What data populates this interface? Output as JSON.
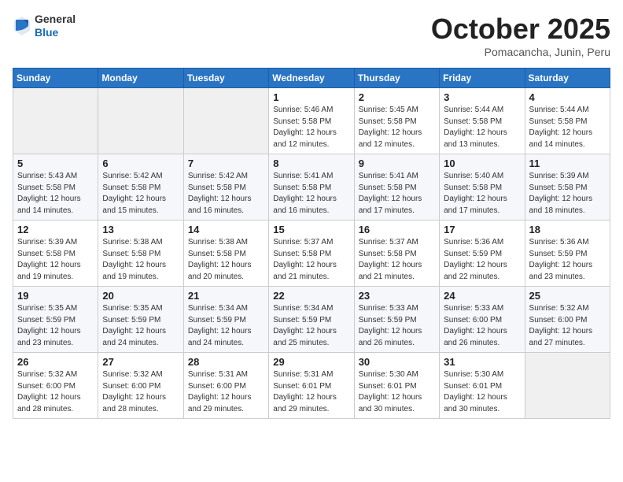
{
  "header": {
    "logo_general": "General",
    "logo_blue": "Blue",
    "month": "October 2025",
    "location": "Pomacancha, Junin, Peru"
  },
  "weekdays": [
    "Sunday",
    "Monday",
    "Tuesday",
    "Wednesday",
    "Thursday",
    "Friday",
    "Saturday"
  ],
  "weeks": [
    [
      {
        "day": "",
        "info": ""
      },
      {
        "day": "",
        "info": ""
      },
      {
        "day": "",
        "info": ""
      },
      {
        "day": "1",
        "info": "Sunrise: 5:46 AM\nSunset: 5:58 PM\nDaylight: 12 hours\nand 12 minutes."
      },
      {
        "day": "2",
        "info": "Sunrise: 5:45 AM\nSunset: 5:58 PM\nDaylight: 12 hours\nand 12 minutes."
      },
      {
        "day": "3",
        "info": "Sunrise: 5:44 AM\nSunset: 5:58 PM\nDaylight: 12 hours\nand 13 minutes."
      },
      {
        "day": "4",
        "info": "Sunrise: 5:44 AM\nSunset: 5:58 PM\nDaylight: 12 hours\nand 14 minutes."
      }
    ],
    [
      {
        "day": "5",
        "info": "Sunrise: 5:43 AM\nSunset: 5:58 PM\nDaylight: 12 hours\nand 14 minutes."
      },
      {
        "day": "6",
        "info": "Sunrise: 5:42 AM\nSunset: 5:58 PM\nDaylight: 12 hours\nand 15 minutes."
      },
      {
        "day": "7",
        "info": "Sunrise: 5:42 AM\nSunset: 5:58 PM\nDaylight: 12 hours\nand 16 minutes."
      },
      {
        "day": "8",
        "info": "Sunrise: 5:41 AM\nSunset: 5:58 PM\nDaylight: 12 hours\nand 16 minutes."
      },
      {
        "day": "9",
        "info": "Sunrise: 5:41 AM\nSunset: 5:58 PM\nDaylight: 12 hours\nand 17 minutes."
      },
      {
        "day": "10",
        "info": "Sunrise: 5:40 AM\nSunset: 5:58 PM\nDaylight: 12 hours\nand 17 minutes."
      },
      {
        "day": "11",
        "info": "Sunrise: 5:39 AM\nSunset: 5:58 PM\nDaylight: 12 hours\nand 18 minutes."
      }
    ],
    [
      {
        "day": "12",
        "info": "Sunrise: 5:39 AM\nSunset: 5:58 PM\nDaylight: 12 hours\nand 19 minutes."
      },
      {
        "day": "13",
        "info": "Sunrise: 5:38 AM\nSunset: 5:58 PM\nDaylight: 12 hours\nand 19 minutes."
      },
      {
        "day": "14",
        "info": "Sunrise: 5:38 AM\nSunset: 5:58 PM\nDaylight: 12 hours\nand 20 minutes."
      },
      {
        "day": "15",
        "info": "Sunrise: 5:37 AM\nSunset: 5:58 PM\nDaylight: 12 hours\nand 21 minutes."
      },
      {
        "day": "16",
        "info": "Sunrise: 5:37 AM\nSunset: 5:58 PM\nDaylight: 12 hours\nand 21 minutes."
      },
      {
        "day": "17",
        "info": "Sunrise: 5:36 AM\nSunset: 5:59 PM\nDaylight: 12 hours\nand 22 minutes."
      },
      {
        "day": "18",
        "info": "Sunrise: 5:36 AM\nSunset: 5:59 PM\nDaylight: 12 hours\nand 23 minutes."
      }
    ],
    [
      {
        "day": "19",
        "info": "Sunrise: 5:35 AM\nSunset: 5:59 PM\nDaylight: 12 hours\nand 23 minutes."
      },
      {
        "day": "20",
        "info": "Sunrise: 5:35 AM\nSunset: 5:59 PM\nDaylight: 12 hours\nand 24 minutes."
      },
      {
        "day": "21",
        "info": "Sunrise: 5:34 AM\nSunset: 5:59 PM\nDaylight: 12 hours\nand 24 minutes."
      },
      {
        "day": "22",
        "info": "Sunrise: 5:34 AM\nSunset: 5:59 PM\nDaylight: 12 hours\nand 25 minutes."
      },
      {
        "day": "23",
        "info": "Sunrise: 5:33 AM\nSunset: 5:59 PM\nDaylight: 12 hours\nand 26 minutes."
      },
      {
        "day": "24",
        "info": "Sunrise: 5:33 AM\nSunset: 6:00 PM\nDaylight: 12 hours\nand 26 minutes."
      },
      {
        "day": "25",
        "info": "Sunrise: 5:32 AM\nSunset: 6:00 PM\nDaylight: 12 hours\nand 27 minutes."
      }
    ],
    [
      {
        "day": "26",
        "info": "Sunrise: 5:32 AM\nSunset: 6:00 PM\nDaylight: 12 hours\nand 28 minutes."
      },
      {
        "day": "27",
        "info": "Sunrise: 5:32 AM\nSunset: 6:00 PM\nDaylight: 12 hours\nand 28 minutes."
      },
      {
        "day": "28",
        "info": "Sunrise: 5:31 AM\nSunset: 6:00 PM\nDaylight: 12 hours\nand 29 minutes."
      },
      {
        "day": "29",
        "info": "Sunrise: 5:31 AM\nSunset: 6:01 PM\nDaylight: 12 hours\nand 29 minutes."
      },
      {
        "day": "30",
        "info": "Sunrise: 5:30 AM\nSunset: 6:01 PM\nDaylight: 12 hours\nand 30 minutes."
      },
      {
        "day": "31",
        "info": "Sunrise: 5:30 AM\nSunset: 6:01 PM\nDaylight: 12 hours\nand 30 minutes."
      },
      {
        "day": "",
        "info": ""
      }
    ]
  ]
}
